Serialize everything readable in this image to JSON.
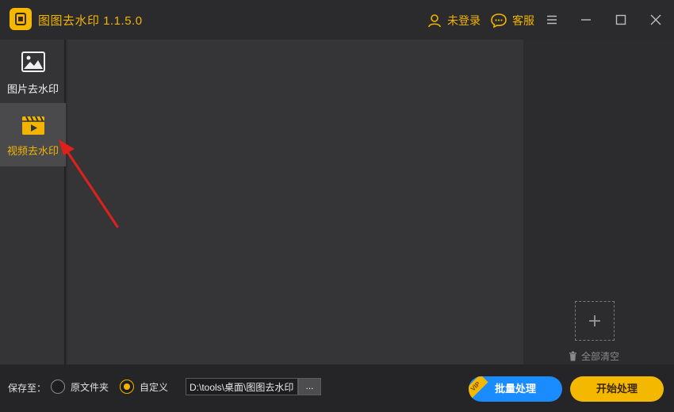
{
  "app": {
    "title": "图图去水印  1.1.5.0",
    "accent_color": "#f2b400"
  },
  "titlebar": {
    "login_label": "未登录",
    "service_label": "客服",
    "icons": [
      "user-icon",
      "chat-icon",
      "menu-icon",
      "minimize-icon",
      "maximize-icon",
      "close-icon"
    ]
  },
  "sidebar": {
    "items": [
      {
        "label": "图片去水印",
        "icon": "image-icon",
        "active": false
      },
      {
        "label": "视频去水印",
        "icon": "video-icon",
        "active": true
      }
    ]
  },
  "right_panel": {
    "add_icon": "plus-icon",
    "clear_label": "全部清空"
  },
  "bottom": {
    "save_to_label": "保存至：",
    "options": [
      {
        "label": "原文件夹",
        "checked": false
      },
      {
        "label": "自定义",
        "checked": true
      }
    ],
    "path_value": "D:\\tools\\桌面\\图图去水印",
    "browse_label": "...",
    "batch_label": "批量处理",
    "vip_label": "VIP",
    "start_label": "开始处理"
  }
}
